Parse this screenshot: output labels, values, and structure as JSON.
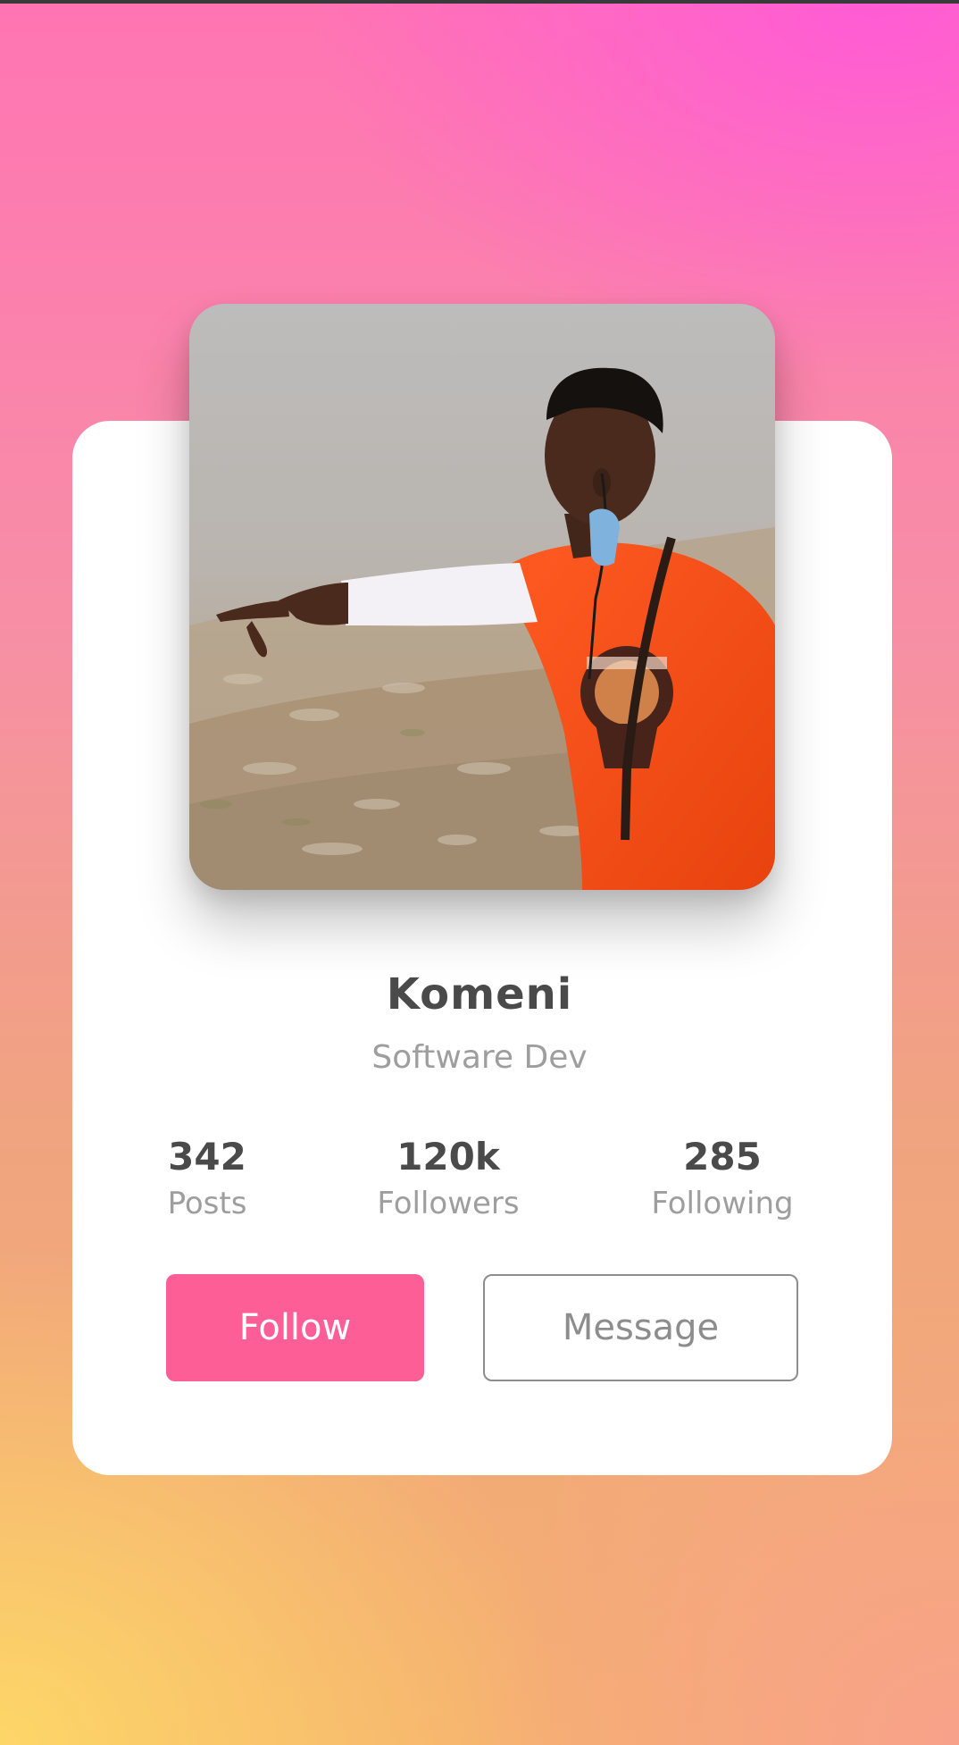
{
  "profile": {
    "name": "Komeni",
    "role": "Software Dev",
    "photo_alt": "Profile photo"
  },
  "stats": [
    {
      "value": "342",
      "label": "Posts"
    },
    {
      "value": "120k",
      "label": "Followers"
    },
    {
      "value": "285",
      "label": "Following"
    }
  ],
  "actions": {
    "follow_label": "Follow",
    "message_label": "Message"
  },
  "colors": {
    "follow_button": "#fd5e95",
    "card": "#ffffff",
    "name_text": "#4a4a4a",
    "muted_text": "#9e9e9e"
  }
}
